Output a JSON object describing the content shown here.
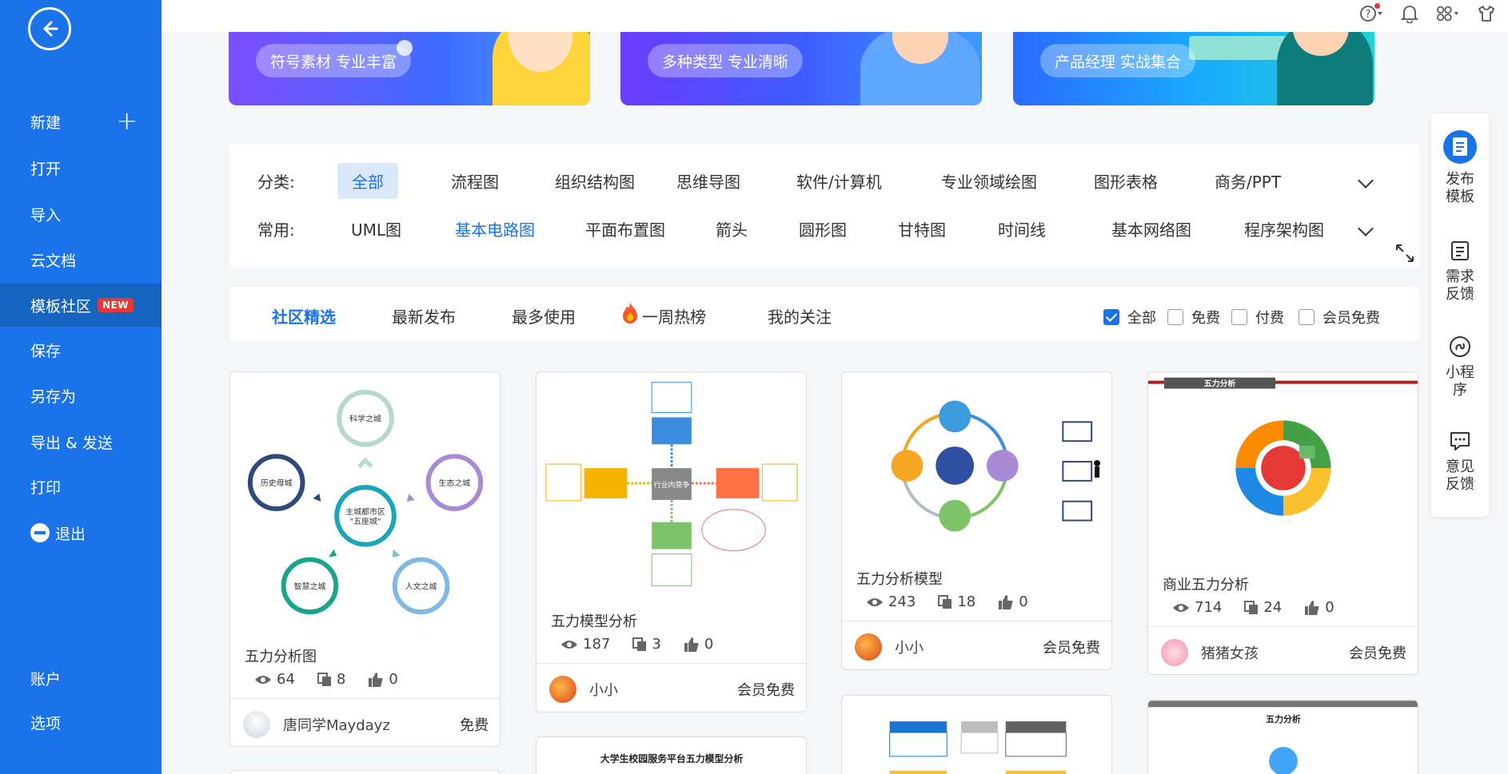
{
  "sidebar": {
    "back_label": "back",
    "items": [
      {
        "label": "新建"
      },
      {
        "label": "打开"
      },
      {
        "label": "导入"
      },
      {
        "label": "云文档"
      },
      {
        "label": "模板社区",
        "badge": "NEW"
      },
      {
        "label": "保存"
      },
      {
        "label": "另存为"
      },
      {
        "label": "导出 & 发送"
      },
      {
        "label": "打印"
      },
      {
        "label": "退出"
      }
    ],
    "bottom": [
      {
        "label": "账户"
      },
      {
        "label": "选项"
      }
    ]
  },
  "banners": [
    {
      "text": "符号素材 专业丰富"
    },
    {
      "text": "多种类型 专业清晰"
    },
    {
      "text": "产品经理 实战集合"
    }
  ],
  "categories": {
    "row1_label": "分类:",
    "row1": [
      "全部",
      "流程图",
      "组织结构图",
      "思维导图",
      "软件/计算机",
      "专业领域绘图",
      "图形表格",
      "商务/PPT"
    ],
    "row2_label": "常用:",
    "row2": [
      "UML图",
      "基本电路图",
      "平面布置图",
      "箭头",
      "圆形图",
      "甘特图",
      "时间线",
      "基本网络图",
      "程序架构图"
    ]
  },
  "tabs": [
    "社区精选",
    "最新发布",
    "最多使用",
    "一周热榜",
    "我的关注"
  ],
  "filters": [
    {
      "label": "全部",
      "checked": true
    },
    {
      "label": "免费",
      "checked": false
    },
    {
      "label": "付费",
      "checked": false
    },
    {
      "label": "会员免费",
      "checked": false
    }
  ],
  "cards": [
    {
      "title": "五力分析图",
      "views": "64",
      "copies": "8",
      "likes": "0",
      "author": "唐同学Maydayz",
      "price": "免费",
      "thumb_text": {
        "center": "主城都市区\n\"五座城\"",
        "n1": "科学之城",
        "n2": "生态之城",
        "n3": "人文之城",
        "n4": "智慧之城",
        "n5": "历史母城"
      }
    },
    {
      "title": "五力模型分析",
      "views": "187",
      "copies": "3",
      "likes": "0",
      "author": "小小",
      "price": "会员免费",
      "thumb_text": {
        "center": "行业内竞争"
      }
    },
    {
      "title": "五力分析模型",
      "views": "243",
      "copies": "18",
      "likes": "0",
      "author": "小小",
      "price": "会员免费"
    },
    {
      "title": "商业五力分析",
      "views": "714",
      "copies": "24",
      "likes": "0",
      "author": "猪猪女孩",
      "price": "会员免费",
      "thumb_text": {
        "header": "五力分析"
      }
    },
    {
      "thumb_text": {
        "header": "大学生校园服务平台五力模型分析"
      }
    },
    {
      "thumb_text": {
        "header": "五力分析"
      }
    }
  ],
  "right_panel": [
    {
      "label": "发布\n模板"
    },
    {
      "label": "需求\n反馈"
    },
    {
      "label": "小程\n序"
    },
    {
      "label": "意见\n反馈"
    }
  ],
  "colors": {
    "accent": "#1a73e8",
    "sidebar": "#1a73e8",
    "badge": "#e53935"
  }
}
